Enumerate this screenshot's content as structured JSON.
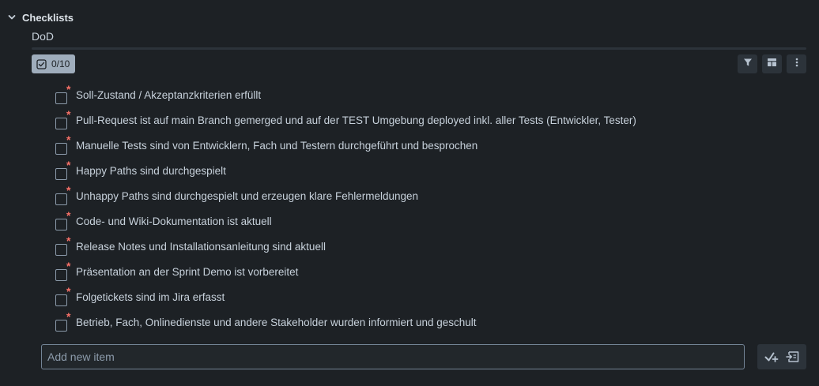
{
  "section": {
    "title": "Checklists",
    "chevron_icon": "chevron-down-icon"
  },
  "checklist": {
    "name": "DoD",
    "count_label": "0/10",
    "progress_fraction": 0,
    "progress_color": "#4bce97",
    "badge_icon": "checkbox-icon"
  },
  "toolbar": {
    "icons": [
      "filter-icon",
      "layout-icon",
      "more-vertical-icon"
    ]
  },
  "items": [
    {
      "label": "Soll-Zustand / Akzeptanzkriterien erfüllt",
      "checked": false,
      "required": true
    },
    {
      "label": "Pull-Request ist auf main Branch gemerged und auf der TEST Umgebung deployed inkl. aller Tests (Entwickler, Tester)",
      "checked": false,
      "required": true
    },
    {
      "label": "Manuelle Tests sind von Entwicklern, Fach und Testern durchgeführt und besprochen",
      "checked": false,
      "required": true
    },
    {
      "label": "Happy Paths sind durchgespielt",
      "checked": false,
      "required": true
    },
    {
      "label": "Unhappy Paths sind durchgespielt und erzeugen klare Fehlermeldungen",
      "checked": false,
      "required": true
    },
    {
      "label": "Code- und Wiki-Dokumentation ist aktuell",
      "checked": false,
      "required": true
    },
    {
      "label": "Release Notes und Installationsanleitung sind aktuell",
      "checked": false,
      "required": true
    },
    {
      "label": "Präsentation an der Sprint Demo ist vorbereitet",
      "checked": false,
      "required": true
    },
    {
      "label": "Folgetickets sind im Jira erfasst",
      "checked": false,
      "required": true
    },
    {
      "label": "Betrieb, Fach, Onlinedienste und andere Stakeholder wurden informiert und geschult",
      "checked": false,
      "required": true
    }
  ],
  "required_marker": "*",
  "required_color": "#f87168",
  "add_item": {
    "placeholder": "Add new item",
    "value": "",
    "action_icons": [
      "check-add-icon",
      "template-insert-icon"
    ]
  }
}
